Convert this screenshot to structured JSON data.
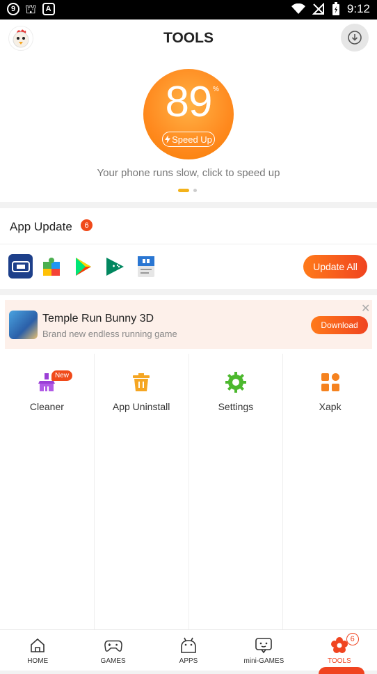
{
  "status_bar": {
    "time": "9:12",
    "left_icons": [
      "mod-icon",
      "bug-icon",
      "a-icon"
    ],
    "right_icons": [
      "wifi-icon",
      "no-signal-icon",
      "battery-icon"
    ]
  },
  "header": {
    "title": "TOOLS",
    "avatar_icon": "chicken-avatar-icon",
    "download_icon": "download-icon"
  },
  "hero": {
    "score": "89",
    "unit": "%",
    "button_label": "Speed Up",
    "caption": "Your phone runs slow, click to speed up",
    "accent": "#ff8a1f"
  },
  "app_update": {
    "title": "App Update",
    "count": "6",
    "apps": [
      "game-controller-app-icon",
      "puzzle-app-icon",
      "play-store-icon",
      "play-games-icon",
      "docs-app-icon"
    ],
    "button_label": "Update All"
  },
  "ad": {
    "title": "Temple Run Bunny 3D",
    "subtitle": "Brand new endless running game",
    "button_label": "Download",
    "close_glyph": "✕"
  },
  "tools": [
    {
      "label": "Cleaner",
      "icon": "cleaner-icon",
      "badge": "New",
      "color": "#9b3fd6"
    },
    {
      "label": "App Uninstall",
      "icon": "trash-icon",
      "color": "#f5a623"
    },
    {
      "label": "Settings",
      "icon": "gear-icon",
      "color": "#4cb82e"
    },
    {
      "label": "Xapk",
      "icon": "xapk-icon",
      "color": "#f5821f"
    }
  ],
  "bottom_nav": {
    "items": [
      {
        "label": "HOME",
        "icon": "home-icon"
      },
      {
        "label": "GAMES",
        "icon": "gamepad-icon"
      },
      {
        "label": "APPS",
        "icon": "android-icon"
      },
      {
        "label": "mini-GAMES",
        "icon": "mini-games-icon"
      },
      {
        "label": "TOOLS",
        "icon": "tools-flower-icon",
        "badge": "6",
        "active": true
      }
    ],
    "active_color": "#f04420"
  }
}
